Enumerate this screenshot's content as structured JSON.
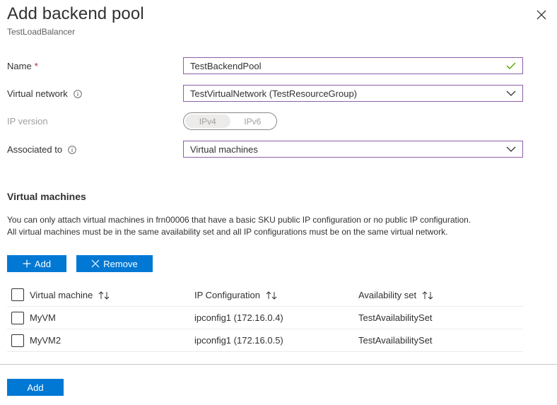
{
  "header": {
    "title": "Add backend pool",
    "subtitle": "TestLoadBalancer"
  },
  "form": {
    "name_label": "Name",
    "name_required_marker": "*",
    "name_value": "TestBackendPool",
    "vnet_label": "Virtual network",
    "vnet_value": "TestVirtualNetwork (TestResourceGroup)",
    "ipversion_label": "IP version",
    "ipversion_options": [
      "IPv4",
      "IPv6"
    ],
    "ipversion_selected": "IPv4",
    "assoc_label": "Associated to",
    "assoc_value": "Virtual machines"
  },
  "vm_section": {
    "title": "Virtual machines",
    "description_line1": "You can only attach virtual machines in frn00006 that have a basic SKU public IP configuration or no public IP configuration.",
    "description_line2": "All virtual machines must be in the same availability set and all IP configurations must be on the same virtual network.",
    "add_label": "Add",
    "remove_label": "Remove"
  },
  "table": {
    "columns": [
      "Virtual machine",
      "IP Configuration",
      "Availability set"
    ],
    "rows": [
      [
        "MyVM",
        "ipconfig1 (172.16.0.4)",
        "TestAvailabilitySet"
      ],
      [
        "MyVM2",
        "ipconfig1 (172.16.0.5)",
        "TestAvailabilitySet"
      ]
    ]
  },
  "footer": {
    "add_label": "Add"
  },
  "colors": {
    "accent": "#0078d4",
    "field_border": "#8a5fa8",
    "valid_check": "#57a300",
    "required": "#a4262c"
  }
}
